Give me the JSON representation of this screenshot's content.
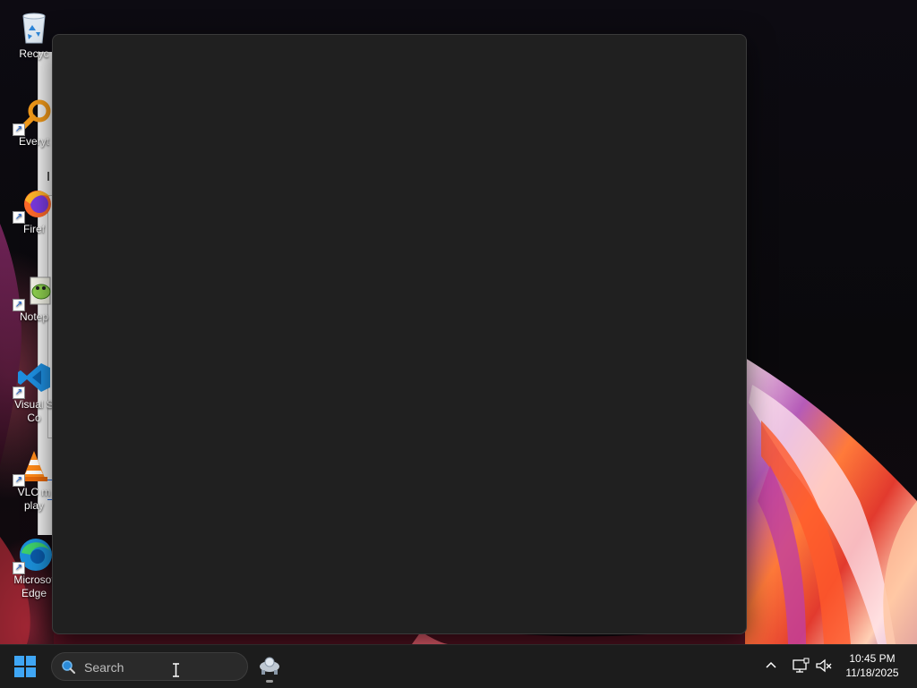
{
  "desktop": {
    "icons": [
      {
        "label": "Recyc",
        "name": "recycle-bin"
      },
      {
        "label": "Everyt",
        "name": "everything"
      },
      {
        "label": "Firef",
        "name": "firefox"
      },
      {
        "label": "Notep",
        "name": "notepad"
      },
      {
        "label": "Visual S",
        "label2": "Co",
        "name": "visual-studio-code"
      },
      {
        "label": "VLC m",
        "label2": "play",
        "name": "vlc"
      },
      {
        "label": "Microsof",
        "label2": "Edge",
        "name": "edge"
      }
    ]
  },
  "taskbar": {
    "search_placeholder": "Search",
    "clock_time": "10:45 PM",
    "clock_date": "11/18/2025"
  },
  "colors": {
    "panel_bg": "#202020",
    "taskbar_bg": "#1c1c1c",
    "start_blue": "#3fa6f5"
  }
}
